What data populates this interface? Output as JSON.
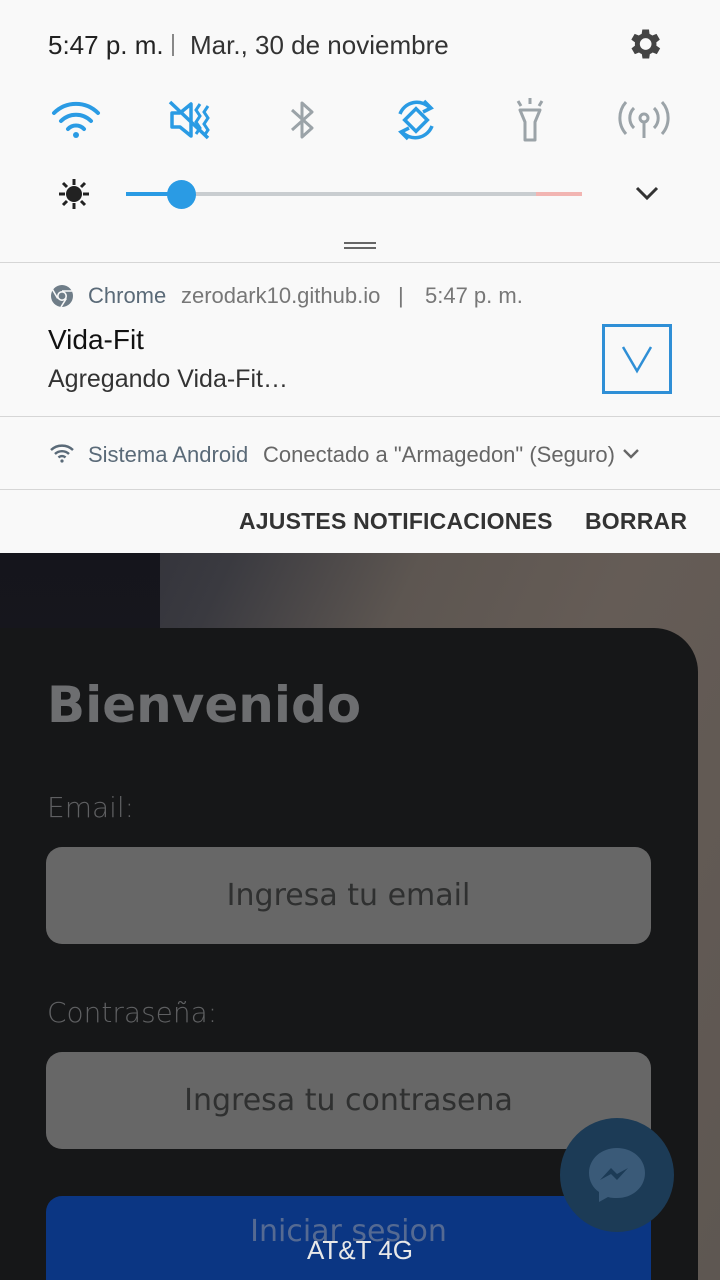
{
  "status": {
    "time": "5:47 p. m.",
    "date": "Mar., 30 de noviembre",
    "settings_icon": "gear-icon"
  },
  "quick_settings": [
    {
      "name": "wifi",
      "icon": "wifi-icon",
      "active": true
    },
    {
      "name": "sound",
      "icon": "vibrate-mute-icon",
      "active": true
    },
    {
      "name": "bluetooth",
      "icon": "bluetooth-icon",
      "active": false
    },
    {
      "name": "auto-rotate",
      "icon": "rotate-icon",
      "active": true
    },
    {
      "name": "flashlight",
      "icon": "flashlight-icon",
      "active": false
    },
    {
      "name": "mobile-hotspot",
      "icon": "hotspot-icon",
      "active": false
    }
  ],
  "brightness": {
    "level": 0.12
  },
  "notification": {
    "app": "Chrome",
    "site": "zerodark10.github.io",
    "separator": "|",
    "time": "5:47 p. m.",
    "title": "Vida-Fit",
    "text": "Agregando Vida-Fit…"
  },
  "system_notification": {
    "app": "Sistema Android",
    "text": "Conectado a \"Armagedon\" (Seguro)"
  },
  "actions": {
    "settings": "AJUSTES NOTIFICACIONES",
    "clear": "BORRAR"
  },
  "app": {
    "title": "Bienvenido",
    "email_label": "Email:",
    "email_placeholder": "Ingresa tu email",
    "password_label": "Contraseña:",
    "password_placeholder": "Ingresa tu contrasena",
    "login_button": "Iniciar sesion",
    "carrier": "AT&T 4G"
  },
  "colors": {
    "accent": "#2a9be4",
    "shade_bg": "#f9f9f9",
    "login_button_bg": "#0b3683"
  }
}
